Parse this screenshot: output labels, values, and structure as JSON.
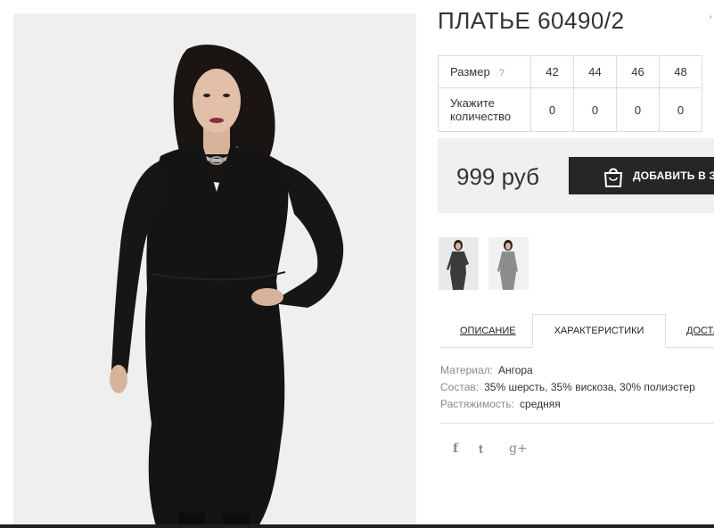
{
  "product": {
    "title": "ПЛАТЬЕ 60490/2",
    "corner_mark": "'"
  },
  "sizes": {
    "label": "Размер",
    "help": "?",
    "values": [
      "42",
      "44",
      "46",
      "48"
    ],
    "qty_label": "Укажите количество",
    "quantities": [
      "0",
      "0",
      "0",
      "0"
    ]
  },
  "price": {
    "amount": "999 руб",
    "cart_button": "ДОБАВИТЬ В ЗА"
  },
  "thumbnails": [
    "dress-front-photo",
    "dress-grey-photo"
  ],
  "tabs": [
    {
      "label": "ОПИСАНИЕ"
    },
    {
      "label": "ХАРАКТЕРИСТИКИ"
    },
    {
      "label": "ДОСТА"
    }
  ],
  "specs": [
    {
      "key": "Материал:",
      "value": "Ангора"
    },
    {
      "key": "Состав:",
      "value": "35% шерсть, 35% вискоза, 30% полиэстер"
    },
    {
      "key": "Растяжимость:",
      "value": "средняя"
    }
  ],
  "social": {
    "facebook": "f",
    "twitter": "t",
    "googleplus": "g+"
  },
  "colors": {
    "button_bg": "#262626",
    "panel_bg": "#f0f0f0",
    "photo_bg": "#efefef"
  },
  "icons": [
    "cart-bag-icon",
    "facebook-icon",
    "twitter-icon",
    "google-plus-icon"
  ]
}
